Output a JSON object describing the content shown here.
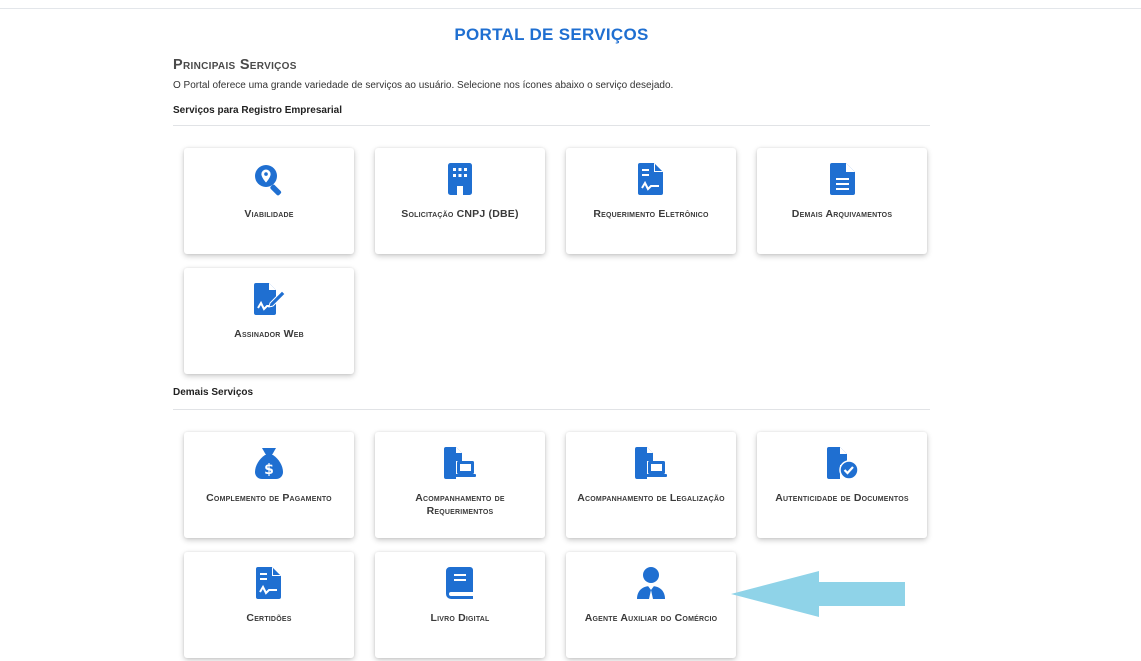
{
  "portal": {
    "title": "PORTAL DE SERVIÇOS",
    "main_heading": "Principais Serviços",
    "intro": "O Portal oferece uma grande variedade de serviços ao usuário. Selecione nos ícones abaixo o serviço desejado."
  },
  "sections": {
    "registro": {
      "title": "Serviços para Registro Empresarial",
      "cards": [
        {
          "label": "Viabilidade",
          "icon": "search-location-icon"
        },
        {
          "label": "Solicitação CNPJ (DBE)",
          "icon": "building-icon"
        },
        {
          "label": "Requerimento Eletrônico",
          "icon": "signed-document-icon"
        },
        {
          "label": "Demais Arquivamentos",
          "icon": "document-icon"
        },
        {
          "label": "Assinador Web",
          "icon": "signature-pen-icon"
        }
      ]
    },
    "demais": {
      "title": "Demais Serviços",
      "cards": [
        {
          "label": "Complemento de Pagamento",
          "icon": "money-bag-icon"
        },
        {
          "label": "Acompanhamento de Requerimentos",
          "icon": "document-laptop-icon"
        },
        {
          "label": "Acompanhamento de Legalização",
          "icon": "document-laptop-icon"
        },
        {
          "label": "Autenticidade de Documentos",
          "icon": "document-check-icon"
        },
        {
          "label": "Certidões",
          "icon": "signed-document-icon"
        },
        {
          "label": "Livro Digital",
          "icon": "book-icon"
        },
        {
          "label": "Agente Auxiliar do Comércio",
          "icon": "user-tie-icon"
        }
      ]
    }
  },
  "colors": {
    "brand_blue": "#1f6fd1",
    "arrow": "#8fd3e8"
  }
}
